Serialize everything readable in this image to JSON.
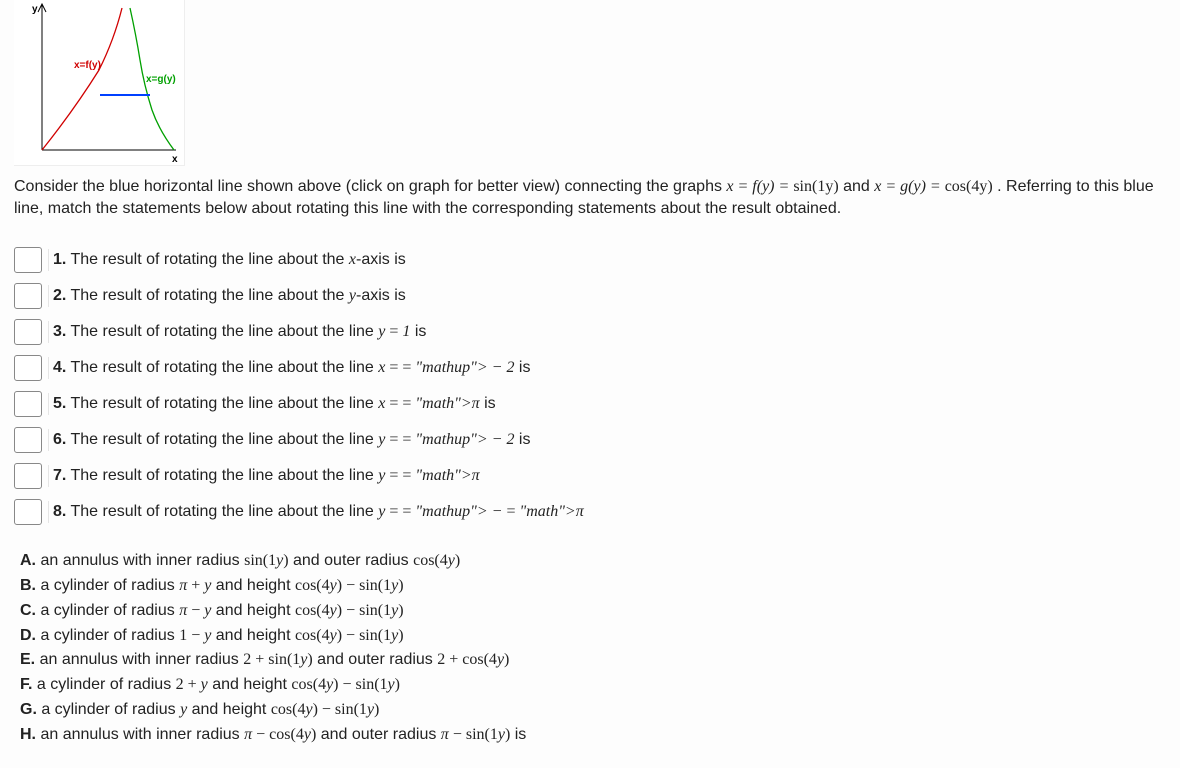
{
  "graph": {
    "y_axis_label": "y",
    "x_axis_label": "x",
    "curve_f_label": "x=f(y)",
    "curve_g_label": "x=g(y)"
  },
  "intro": {
    "p1_a": "Consider the blue horizontal line shown above (click on graph for better view) connecting the graphs ",
    "eq1_lhs": "x = f(y) = ",
    "eq1_rhs": "sin(1y)",
    "p1_b": " and ",
    "eq2_lhs": "x = g(y) = ",
    "eq2_rhs": "cos(4y)",
    "p1_c": ". Referring to this blue line, match the statements below about rotating this line with the corresponding statements about the result obtained."
  },
  "questions": [
    {
      "num": "1.",
      "pre": " The result of rotating the line about the ",
      "axis": "x",
      "post": "-axis is"
    },
    {
      "num": "2.",
      "pre": " The result of rotating the line about the ",
      "axis": "y",
      "post": "-axis is"
    },
    {
      "num": "3.",
      "pre": " The result of rotating the line about the line ",
      "eq": "y = 1",
      "post": " is"
    },
    {
      "num": "4.",
      "pre": " The result of rotating the line about the line ",
      "eq": "x = −2",
      "post": " is"
    },
    {
      "num": "5.",
      "pre": " The result of rotating the line about the line ",
      "eq": "x = π",
      "post": " is"
    },
    {
      "num": "6.",
      "pre": " The result of rotating the line about the line ",
      "eq": "y = −2",
      "post": " is"
    },
    {
      "num": "7.",
      "pre": " The result of rotating the line about the line ",
      "eq": "y = π",
      "post": ""
    },
    {
      "num": "8.",
      "pre": " The result of rotating the line about the line ",
      "eq": "y = −π",
      "post": ""
    }
  ],
  "answers": [
    {
      "label": "A.",
      "pre": " an annulus with inner radius ",
      "m1": "sin(1y)",
      "mid": " and outer radius ",
      "m2": "cos(4y)",
      "post": ""
    },
    {
      "label": "B.",
      "pre": " a cylinder of radius ",
      "m1": "π + y",
      "mid": " and height ",
      "m2": "cos(4y) − sin(1y)",
      "post": ""
    },
    {
      "label": "C.",
      "pre": " a cylinder of radius ",
      "m1": "π − y",
      "mid": " and height ",
      "m2": "cos(4y) − sin(1y)",
      "post": ""
    },
    {
      "label": "D.",
      "pre": " a cylinder of radius ",
      "m1": "1 − y",
      "mid": " and height ",
      "m2": "cos(4y) − sin(1y)",
      "post": ""
    },
    {
      "label": "E.",
      "pre": " an annulus with inner radius ",
      "m1": "2 + sin(1y)",
      "mid": " and outer radius ",
      "m2": "2 + cos(4y)",
      "post": ""
    },
    {
      "label": "F.",
      "pre": " a cylinder of radius ",
      "m1": "2 + y",
      "mid": " and height ",
      "m2": "cos(4y) − sin(1y)",
      "post": ""
    },
    {
      "label": "G.",
      "pre": " a cylinder of radius ",
      "m1": "y",
      "mid": " and height ",
      "m2": "cos(4y) − sin(1y)",
      "post": ""
    },
    {
      "label": "H.",
      "pre": " an annulus with inner radius ",
      "m1": "π − cos(4y)",
      "mid": " and outer radius ",
      "m2": "π − sin(1y)",
      "post": " is"
    }
  ]
}
